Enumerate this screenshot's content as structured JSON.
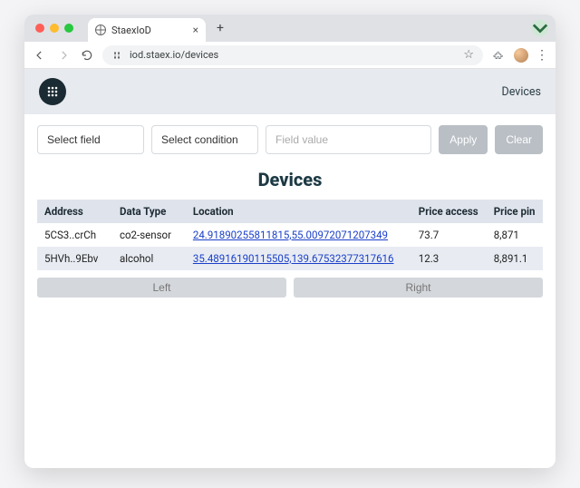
{
  "browser": {
    "tab_title": "StaexIoD",
    "url": "iod.staex.io/devices"
  },
  "header": {
    "nav_link": "Devices"
  },
  "filters": {
    "select_field_placeholder": "Select field",
    "select_condition_placeholder": "Select condition",
    "value_placeholder": "Field value",
    "apply_label": "Apply",
    "clear_label": "Clear"
  },
  "page": {
    "title": "Devices"
  },
  "table": {
    "columns": {
      "address": "Address",
      "data_type": "Data Type",
      "location": "Location",
      "price_access": "Price access",
      "price_pin": "Price pin"
    },
    "rows": [
      {
        "address": "5CS3..crCh",
        "data_type": "co2-sensor",
        "location": "24.91890255811815,55.00972071207349",
        "price_access": "73.7",
        "price_pin": "8,871"
      },
      {
        "address": "5HVh..9Ebv",
        "data_type": "alcohol",
        "location": "35.48916190115505,139.67532377317616",
        "price_access": "12.3",
        "price_pin": "8,891.1"
      }
    ]
  },
  "pager": {
    "left_label": "Left",
    "right_label": "Right"
  }
}
